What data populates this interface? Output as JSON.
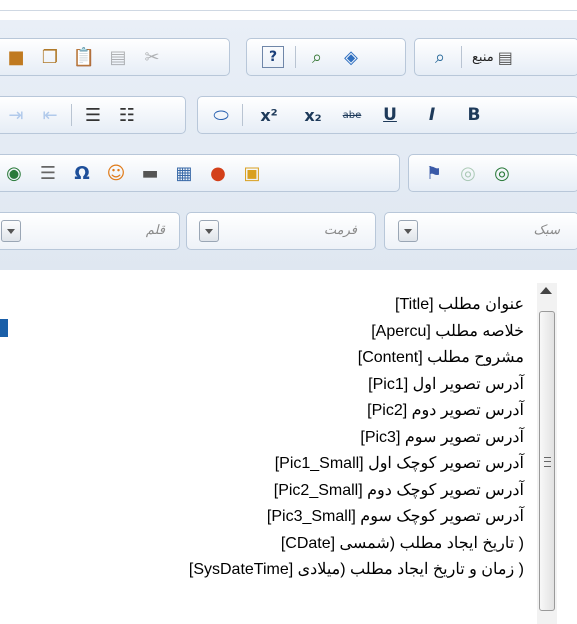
{
  "toolbar": {
    "row1": {
      "group_a": [
        "cut-icon",
        "copy-icon",
        "paste-icon",
        "paste-text-icon",
        "paste-word-icon"
      ],
      "group_b": [
        "help-icon",
        "find-icon",
        "select-all-icon"
      ],
      "group_c": [
        "preview-icon",
        "source-icon"
      ],
      "source_label": "منبع"
    },
    "row2": {
      "group_a": [
        "indent-icon",
        "outdent-icon",
        "bullet-list-icon",
        "numbered-list-icon"
      ],
      "group_b": {
        "superscript": "x²",
        "subscript": "x₂",
        "strike": "abe",
        "underline": "U",
        "italic": "I",
        "bold": "B"
      }
    },
    "row3": {
      "group_a": [
        "globe-icon",
        "page-break-icon",
        "omega-icon",
        "smiley-icon",
        "horizontal-line-icon",
        "table-icon",
        "flash-icon",
        "image-icon"
      ],
      "group_b": [
        "anchor-icon",
        "link-icon",
        "unlink-icon"
      ]
    },
    "combos": {
      "size": "قلم",
      "format": "فرمت",
      "style": "سبک"
    }
  },
  "list": {
    "items": [
      "عنوان مطلب [Title]",
      "خلاصه مطلب [Apercu]",
      "مشروح مطلب [Content]",
      "آدرس تصویر اول [Pic1]",
      "آدرس تصویر دوم [Pic2]",
      "آدرس تصویر سوم [Pic3]",
      "آدرس تصویر کوچک اول [Pic1_Small]",
      "آدرس تصویر کوچک دوم [Pic2_Small]",
      "آدرس تصویر کوچک سوم [Pic3_Small]",
      "( تاریخ ایجاد مطلب (شمسی [CDate]",
      "( زمان و تاریخ ایجاد مطلب (میلادی [SysDateTime]"
    ]
  }
}
